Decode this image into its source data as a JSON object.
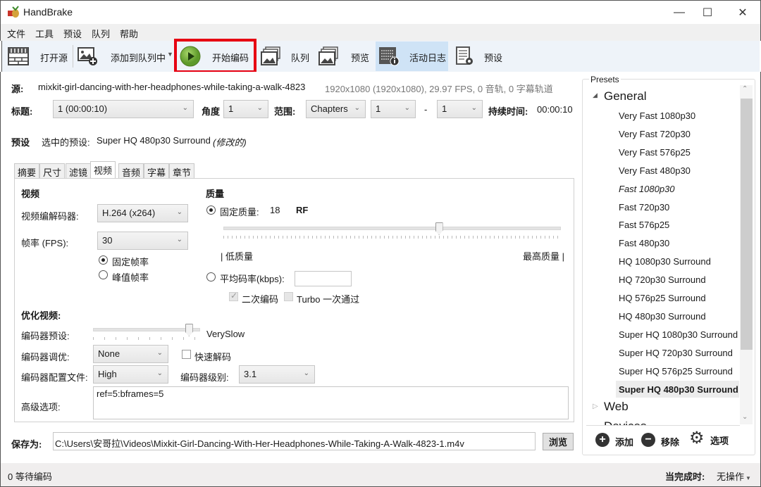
{
  "window": {
    "title": "HandBrake",
    "controls": {
      "minimize": "—",
      "maximize": "☐",
      "close": "✕"
    }
  },
  "menu": [
    "文件",
    "工具",
    "预设",
    "队列",
    "帮助"
  ],
  "toolbar": {
    "open_source": "打开源",
    "add_to_queue": "添加到队列中",
    "start_encode": "开始编码",
    "queue": "队列",
    "preview": "预览",
    "activity_log": "活动日志",
    "presets": "预设",
    "highlight_color": "#e60012"
  },
  "source": {
    "label": "源:",
    "name": "mixkit-girl-dancing-with-her-headphones-while-taking-a-walk-4823",
    "info": "1920x1080 (1920x1080), 29.97 FPS, 0 音轨, 0 字幕轨道"
  },
  "title_row": {
    "title_label": "标题:",
    "title_value": "1 (00:00:10)",
    "angle_label": "角度",
    "angle_value": "1",
    "range_label": "范围:",
    "range_type": "Chapters",
    "range_start": "1",
    "range_sep": "-",
    "range_end": "1",
    "duration_label": "持续时间:",
    "duration_value": "00:00:10"
  },
  "preset_row": {
    "label": "预设",
    "selected_label": "选中的预设:",
    "selected_value": "Super HQ 480p30 Surround",
    "modified": "(修改的)"
  },
  "tabs": [
    "摘要",
    "尺寸",
    "滤镜",
    "视频",
    "音频",
    "字幕",
    "章节"
  ],
  "active_tab": "视频",
  "video": {
    "section_title": "视频",
    "codec_label": "视频编解码器:",
    "codec_value": "H.264 (x264)",
    "fps_label": "帧率 (FPS):",
    "fps_value": "30",
    "constant_fps": "固定帧率",
    "peak_fps": "峰值帧率",
    "constant_fps_selected": true
  },
  "quality": {
    "section_title": "质量",
    "constant_quality_label": "固定质量:",
    "constant_quality_value": "18",
    "unit": "RF",
    "slider_fraction": 0.64,
    "low_label": "| 低质量",
    "high_label": "最高质量 |",
    "avg_bitrate_label": "平均码率(kbps):",
    "avg_bitrate_value": "",
    "two_pass_label": "二次编码",
    "two_pass_checked": true,
    "turbo_label": "Turbo 一次通过",
    "turbo_checked": false
  },
  "optimize": {
    "section_title": "优化视频:",
    "encoder_preset_label": "编码器预设:",
    "encoder_preset_value": "VerySlow",
    "encoder_preset_fraction": 0.9,
    "tune_label": "编码器调优:",
    "tune_value": "None",
    "fast_decode_label": "快速解码",
    "fast_decode_checked": false,
    "profile_label": "编码器配置文件:",
    "profile_value": "High",
    "level_label": "编码器级别:",
    "level_value": "3.1",
    "advanced_label": "高级选项:",
    "advanced_value": "ref=5:bframes=5"
  },
  "save": {
    "label": "保存为:",
    "path": "C:\\Users\\安哥拉\\Videos\\Mixkit-Girl-Dancing-With-Her-Headphones-While-Taking-A-Walk-4823-1.m4v",
    "browse": "浏览"
  },
  "presets_panel": {
    "title": "Presets",
    "groups": [
      {
        "name": "General",
        "expanded": true
      },
      {
        "name": "Web",
        "expanded": false
      },
      {
        "name": "Devices",
        "expanded": false
      }
    ],
    "items": [
      {
        "name": "Very Fast 1080p30",
        "style": "normal"
      },
      {
        "name": "Very Fast 720p30",
        "style": "normal"
      },
      {
        "name": "Very Fast 576p25",
        "style": "normal"
      },
      {
        "name": "Very Fast 480p30",
        "style": "normal"
      },
      {
        "name": "Fast 1080p30",
        "style": "italic"
      },
      {
        "name": "Fast 720p30",
        "style": "normal"
      },
      {
        "name": "Fast 576p25",
        "style": "normal"
      },
      {
        "name": "Fast 480p30",
        "style": "normal"
      },
      {
        "name": "HQ 1080p30 Surround",
        "style": "normal"
      },
      {
        "name": "HQ 720p30 Surround",
        "style": "normal"
      },
      {
        "name": "HQ 576p25 Surround",
        "style": "normal"
      },
      {
        "name": "HQ 480p30 Surround",
        "style": "normal"
      },
      {
        "name": "Super HQ 1080p30 Surround",
        "style": "normal"
      },
      {
        "name": "Super HQ 720p30 Surround",
        "style": "normal"
      },
      {
        "name": "Super HQ 576p25 Surround",
        "style": "normal"
      },
      {
        "name": "Super HQ 480p30 Surround",
        "style": "selected"
      }
    ],
    "add": "添加",
    "remove": "移除",
    "options": "选项"
  },
  "status": {
    "queue_text": "0 等待编码",
    "when_done_label": "当完成时:",
    "when_done_value": "无操作"
  }
}
